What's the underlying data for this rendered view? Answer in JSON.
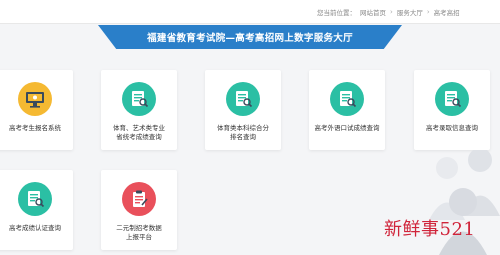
{
  "breadcrumb": {
    "prefix": "您当前位置：",
    "items": [
      "网站首页",
      "服务大厅",
      "高考高招"
    ]
  },
  "banner": {
    "title": "福建省教育考试院—高考高招网上数字服务大厅"
  },
  "cards": [
    {
      "label": "高考考生报名系统",
      "color": "#f5b932"
    },
    {
      "label": "体育、艺术类专业\n省统考成绩查询",
      "color": "#2bbfa4"
    },
    {
      "label": "体育类本科综合分\n排名查询",
      "color": "#2bbfa4"
    },
    {
      "label": "高考外语口试成绩查询",
      "color": "#2bbfa4"
    },
    {
      "label": "高考录取信息查询",
      "color": "#2bbfa4"
    },
    {
      "label": "高考成绩认证查询",
      "color": "#2bbfa4"
    },
    {
      "label": "二元制招考数据\n上报平台",
      "color": "#e9505b"
    }
  ],
  "watermark": {
    "text": "新鲜事521"
  }
}
